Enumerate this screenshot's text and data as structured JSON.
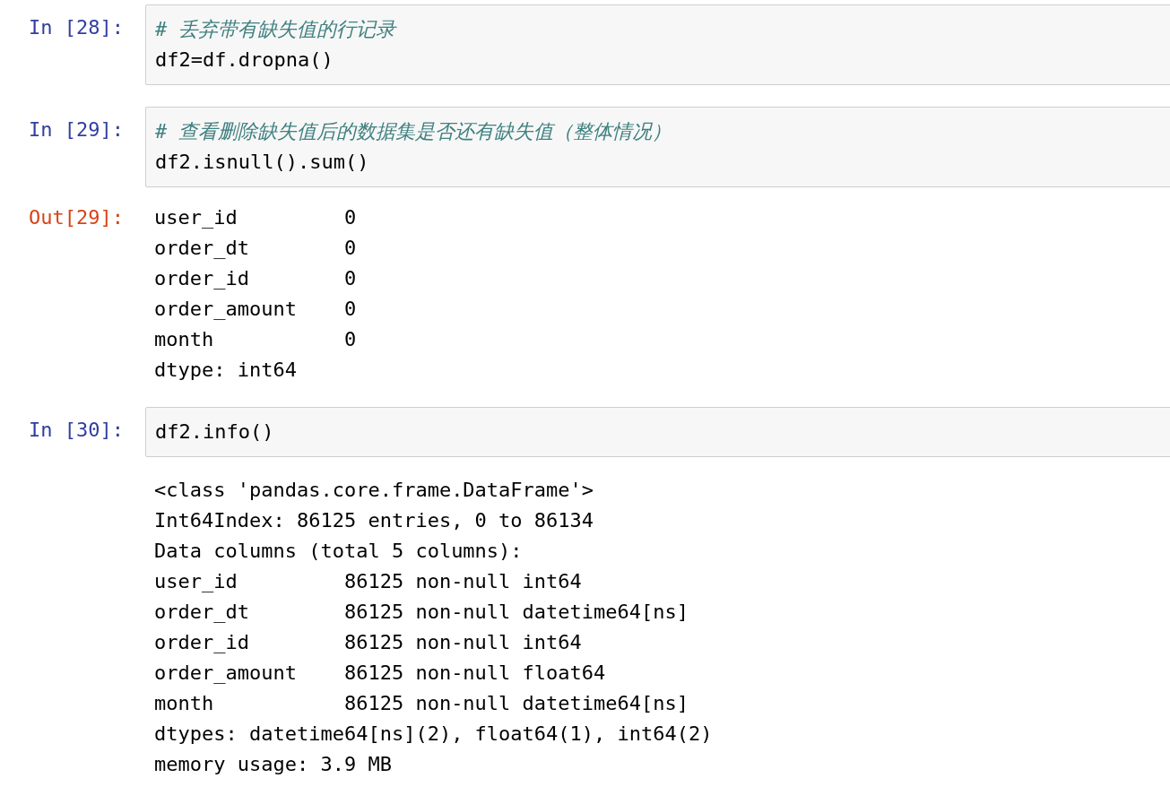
{
  "cells": [
    {
      "prompt": "In [28]:",
      "source": [
        {
          "kind": "comment",
          "text": "# 丢弃带有缺失值的行记录"
        },
        {
          "kind": "code",
          "text": "df2=df.dropna()"
        }
      ]
    },
    {
      "prompt": "In [29]:",
      "source": [
        {
          "kind": "comment",
          "text": "# 查看删除缺失值后的数据集是否还有缺失值（整体情况）"
        },
        {
          "kind": "code",
          "text": "df2.isnull().sum()"
        }
      ],
      "output": {
        "prompt": "Out[29]:",
        "lines": [
          "user_id         0",
          "order_dt        0",
          "order_id        0",
          "order_amount    0",
          "month           0",
          "dtype: int64"
        ]
      }
    },
    {
      "prompt": "In [30]:",
      "source": [
        {
          "kind": "code",
          "text": "df2.info()"
        }
      ],
      "output": {
        "lines": [
          "<class 'pandas.core.frame.DataFrame'>",
          "Int64Index: 86125 entries, 0 to 86134",
          "Data columns (total 5 columns):",
          "user_id         86125 non-null int64",
          "order_dt        86125 non-null datetime64[ns]",
          "order_id        86125 non-null int64",
          "order_amount    86125 non-null float64",
          "month           86125 non-null datetime64[ns]",
          "dtypes: datetime64[ns](2), float64(1), int64(2)",
          "memory usage: 3.9 MB"
        ]
      }
    }
  ]
}
